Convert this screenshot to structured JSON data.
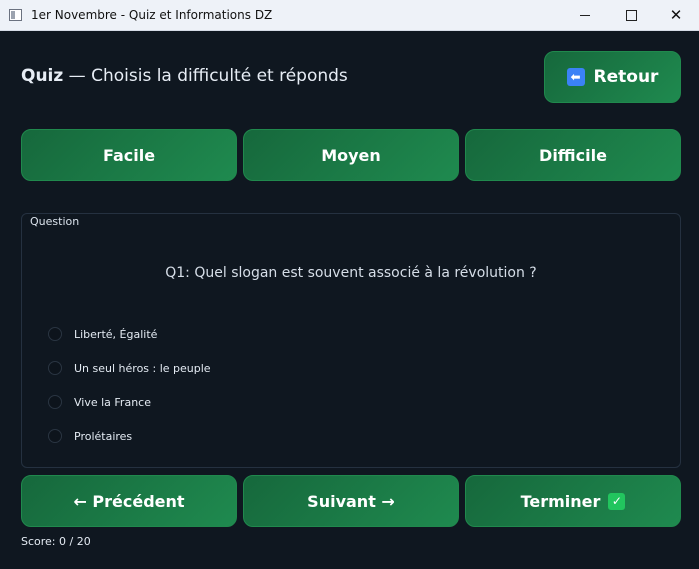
{
  "window": {
    "title": "1er Novembre - Quiz et Informations DZ",
    "minimize_glyph": "",
    "maximize_glyph": "",
    "close_glyph": "✕"
  },
  "header": {
    "title_bold": "Quiz",
    "title_rest": " — Choisis la difficulté et réponds",
    "back_label": "Retour",
    "back_icon": "arrow-left-icon",
    "back_icon_glyph": "⬅"
  },
  "difficulty": {
    "buttons": [
      "Facile",
      "Moyen",
      "Difficile"
    ]
  },
  "question": {
    "group_label": "Question",
    "text": "Q1: Quel slogan est souvent associé à la révolution ?",
    "options": [
      "Liberté, Égalité",
      "Un seul héros : le peuple",
      "Vive la France",
      "Prolétaires"
    ]
  },
  "navigation": {
    "prev_label": "← Précédent",
    "next_label": "Suivant →",
    "finish_label": "Terminer",
    "finish_icon": "check-icon",
    "finish_icon_glyph": "✓"
  },
  "score": {
    "text": "Score: 0 / 20"
  },
  "colors": {
    "background": "#0f1720",
    "button_green": "#1a7a45",
    "text": "#e4ebf3"
  }
}
